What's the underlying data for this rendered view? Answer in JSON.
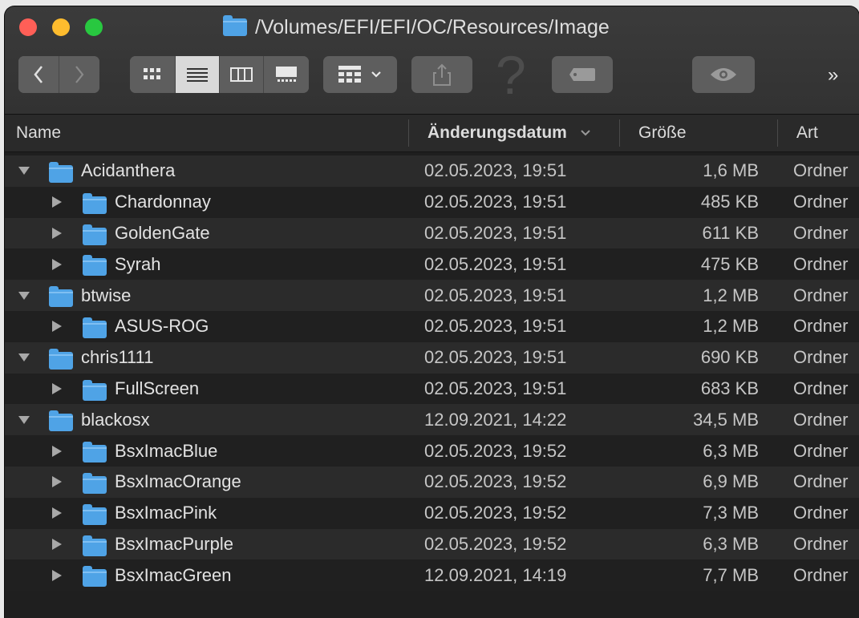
{
  "window": {
    "path_title": "/Volumes/EFI/EFI/OC/Resources/Image"
  },
  "toolbar": {
    "back_icon": "chevron-left-icon",
    "forward_icon": "chevron-right-icon",
    "view_modes": [
      "icon-view-icon",
      "list-view-icon",
      "column-view-icon",
      "gallery-view-icon"
    ],
    "active_view": "list",
    "group_icon": "group-by-icon",
    "share_icon": "share-icon",
    "help_glyph": "?",
    "tag_icon": "tag-icon",
    "quicklook_icon": "eye-icon",
    "overflow_glyph": "»"
  },
  "columns": {
    "name": "Name",
    "date": "Änderungsdatum",
    "size": "Größe",
    "kind": "Art"
  },
  "rows": [
    {
      "level": 0,
      "expanded": true,
      "name": "Acidanthera",
      "date": "02.05.2023, 19:51",
      "size": "1,6 MB",
      "kind": "Ordner"
    },
    {
      "level": 1,
      "expanded": false,
      "name": "Chardonnay",
      "date": "02.05.2023, 19:51",
      "size": "485 KB",
      "kind": "Ordner"
    },
    {
      "level": 1,
      "expanded": false,
      "name": "GoldenGate",
      "date": "02.05.2023, 19:51",
      "size": "611 KB",
      "kind": "Ordner"
    },
    {
      "level": 1,
      "expanded": false,
      "name": "Syrah",
      "date": "02.05.2023, 19:51",
      "size": "475 KB",
      "kind": "Ordner"
    },
    {
      "level": 0,
      "expanded": true,
      "name": "btwise",
      "date": "02.05.2023, 19:51",
      "size": "1,2 MB",
      "kind": "Ordner"
    },
    {
      "level": 1,
      "expanded": false,
      "name": "ASUS-ROG",
      "date": "02.05.2023, 19:51",
      "size": "1,2 MB",
      "kind": "Ordner"
    },
    {
      "level": 0,
      "expanded": true,
      "name": "chris1111",
      "date": "02.05.2023, 19:51",
      "size": "690 KB",
      "kind": "Ordner"
    },
    {
      "level": 1,
      "expanded": false,
      "name": "FullScreen",
      "date": "02.05.2023, 19:51",
      "size": "683 KB",
      "kind": "Ordner"
    },
    {
      "level": 0,
      "expanded": true,
      "name": "blackosx",
      "date": "12.09.2021, 14:22",
      "size": "34,5 MB",
      "kind": "Ordner"
    },
    {
      "level": 1,
      "expanded": false,
      "name": "BsxImacBlue",
      "date": "02.05.2023, 19:52",
      "size": "6,3 MB",
      "kind": "Ordner"
    },
    {
      "level": 1,
      "expanded": false,
      "name": "BsxImacOrange",
      "date": "02.05.2023, 19:52",
      "size": "6,9 MB",
      "kind": "Ordner"
    },
    {
      "level": 1,
      "expanded": false,
      "name": "BsxImacPink",
      "date": "02.05.2023, 19:52",
      "size": "7,3 MB",
      "kind": "Ordner"
    },
    {
      "level": 1,
      "expanded": false,
      "name": "BsxImacPurple",
      "date": "02.05.2023, 19:52",
      "size": "6,3 MB",
      "kind": "Ordner"
    },
    {
      "level": 1,
      "expanded": false,
      "name": "BsxImacGreen",
      "date": "12.09.2021, 14:19",
      "size": "7,7 MB",
      "kind": "Ordner"
    }
  ],
  "colors": {
    "folder": "#4fa3e6",
    "close": "#ff5f57",
    "minimize": "#febc2e",
    "zoom": "#28c840"
  }
}
